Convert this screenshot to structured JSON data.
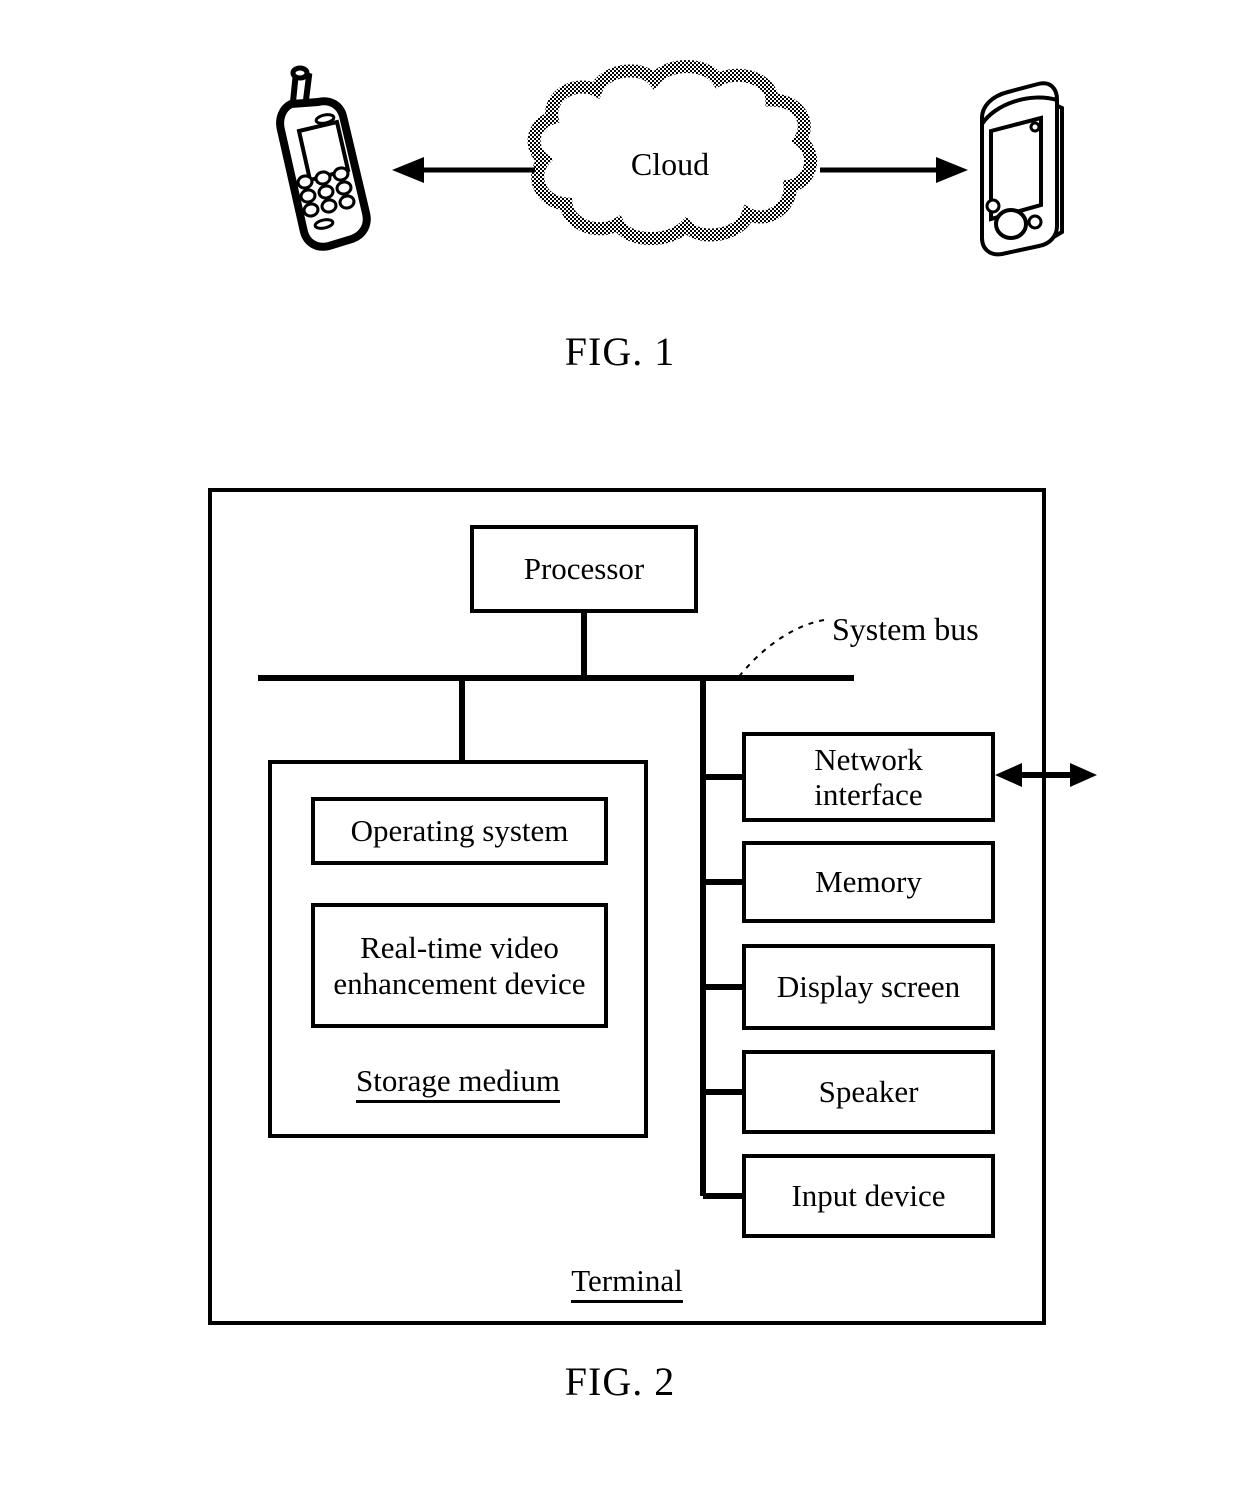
{
  "document": {
    "type": "patent-figure-sheet",
    "figures": [
      "FIG. 1",
      "FIG. 2"
    ]
  },
  "fig1": {
    "caption": "FIG. 1",
    "cloud_label": "Cloud",
    "left_device": "mobile-phone",
    "right_device": "pda-handheld",
    "left_arrow": "cloud-to-mobile-phone",
    "right_arrow": "cloud-to-pda"
  },
  "fig2": {
    "caption": "FIG. 2",
    "terminal_label": "Terminal",
    "processor_label": "Processor",
    "system_bus_label": "System bus",
    "storage": {
      "title": "Storage medium",
      "items": [
        {
          "label": "Operating system"
        },
        {
          "label": "Real-time video\nenhancement device",
          "line1": "Real-time video",
          "line2": "enhancement device"
        }
      ]
    },
    "peripherals": [
      {
        "label": "Network interface",
        "line1": "Network",
        "line2": "interface"
      },
      {
        "label": "Memory"
      },
      {
        "label": "Display screen"
      },
      {
        "label": "Speaker"
      },
      {
        "label": "Input device"
      }
    ],
    "external_link": "bidirectional-network-arrow"
  },
  "colors": {
    "ink": "#000000",
    "paper": "#ffffff"
  }
}
